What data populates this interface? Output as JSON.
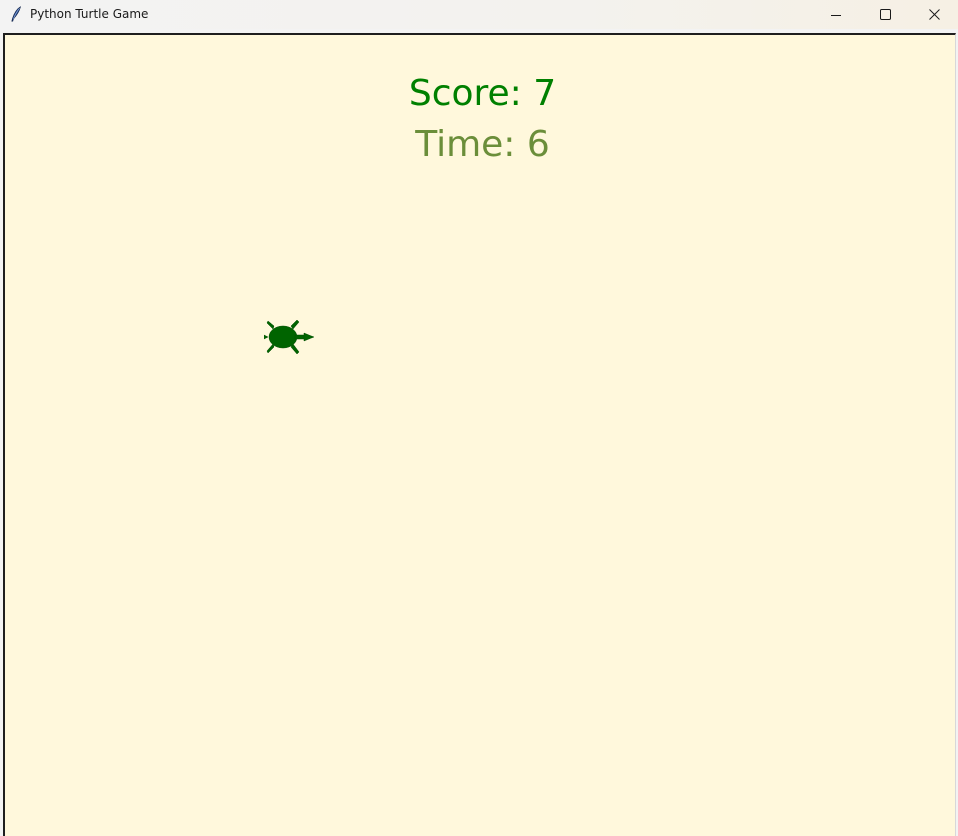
{
  "window": {
    "title": "Python Turtle Game",
    "app_icon": "feather-pen-icon",
    "controls": {
      "minimize_icon": "minimize-icon",
      "maximize_icon": "maximize-icon",
      "close_icon": "close-icon"
    }
  },
  "game": {
    "background_color": "#fff8dc",
    "score_label": "Score: 7",
    "time_label": "Time: 6",
    "score_color": "#008000",
    "time_color": "#6b8e3a",
    "turtle": {
      "icon": "turtle-icon",
      "color": "#006400",
      "heading": "east"
    }
  }
}
